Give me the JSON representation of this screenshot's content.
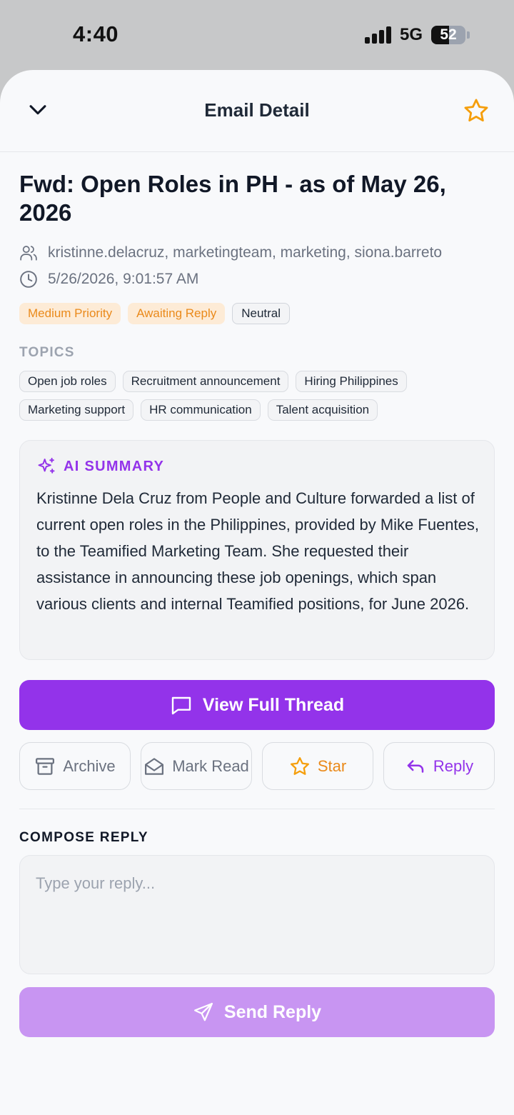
{
  "status_bar": {
    "time": "4:40",
    "network": "5G",
    "battery": "52",
    "battery_level": 0.52
  },
  "header": {
    "title": "Email Detail",
    "back_icon": "chevron-down-icon",
    "star_icon": "star-icon"
  },
  "email": {
    "subject": "Fwd: Open Roles in PH - as of May 26, 2026",
    "recipients": "kristinne.delacruz, marketingteam, marketing, siona.barreto",
    "timestamp": "5/26/2026, 9:01:57 AM",
    "badges": [
      "Medium Priority",
      "Awaiting Reply",
      "Neutral"
    ]
  },
  "topics": {
    "label": "TOPICS",
    "items": [
      "Open job roles",
      "Recruitment announcement",
      "Hiring Philippines",
      "Marketing support",
      "HR communication",
      "Talent acquisition"
    ]
  },
  "ai_summary": {
    "title": "AI SUMMARY",
    "body": "Kristinne Dela Cruz from People and Culture forwarded a list of current open roles in the Philippines, provided by Mike Fuentes, to the Teamified Marketing Team. She requested their assistance in announcing these job openings, which span various clients and internal Teamified positions, for June 2026."
  },
  "buttons": {
    "view_thread": "View Full Thread",
    "archive": "Archive",
    "mark_read": "Mark Read",
    "star": "Star",
    "reply": "Reply",
    "send_reply": "Send Reply"
  },
  "compose": {
    "label": "COMPOSE REPLY",
    "placeholder": "Type your reply...",
    "value": ""
  },
  "colors": {
    "accent": "#9333ea",
    "accent_disabled": "#c895f2",
    "orange": "#ea8a1b",
    "orange_bg": "#fdebd6"
  }
}
